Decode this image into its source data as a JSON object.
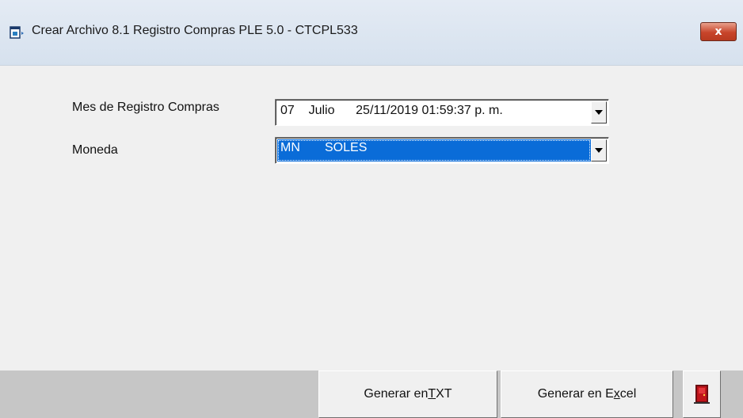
{
  "window": {
    "title": "Crear Archivo 8.1 Registro Compras PLE 5.0 - CTCPL533",
    "close_label": "x",
    "title_icon": "app-window-icon"
  },
  "form": {
    "mes_label": "Mes de Registro Compras",
    "mes_value": "07    Julio      25/11/2019 01:59:37 p. m.",
    "moneda_label": "Moneda",
    "moneda_value": "MN       SOLES"
  },
  "buttons": {
    "txt_prefix": "Generar en ",
    "txt_accel": "T",
    "txt_suffix": "XT",
    "excel_prefix": "Generar  en E",
    "excel_accel": "x",
    "excel_suffix": "cel",
    "exit_icon": "exit-door-icon"
  },
  "colors": {
    "selection": "#0a6cd8",
    "close_button": "#c8452b",
    "exit_door": "#c0141a"
  }
}
